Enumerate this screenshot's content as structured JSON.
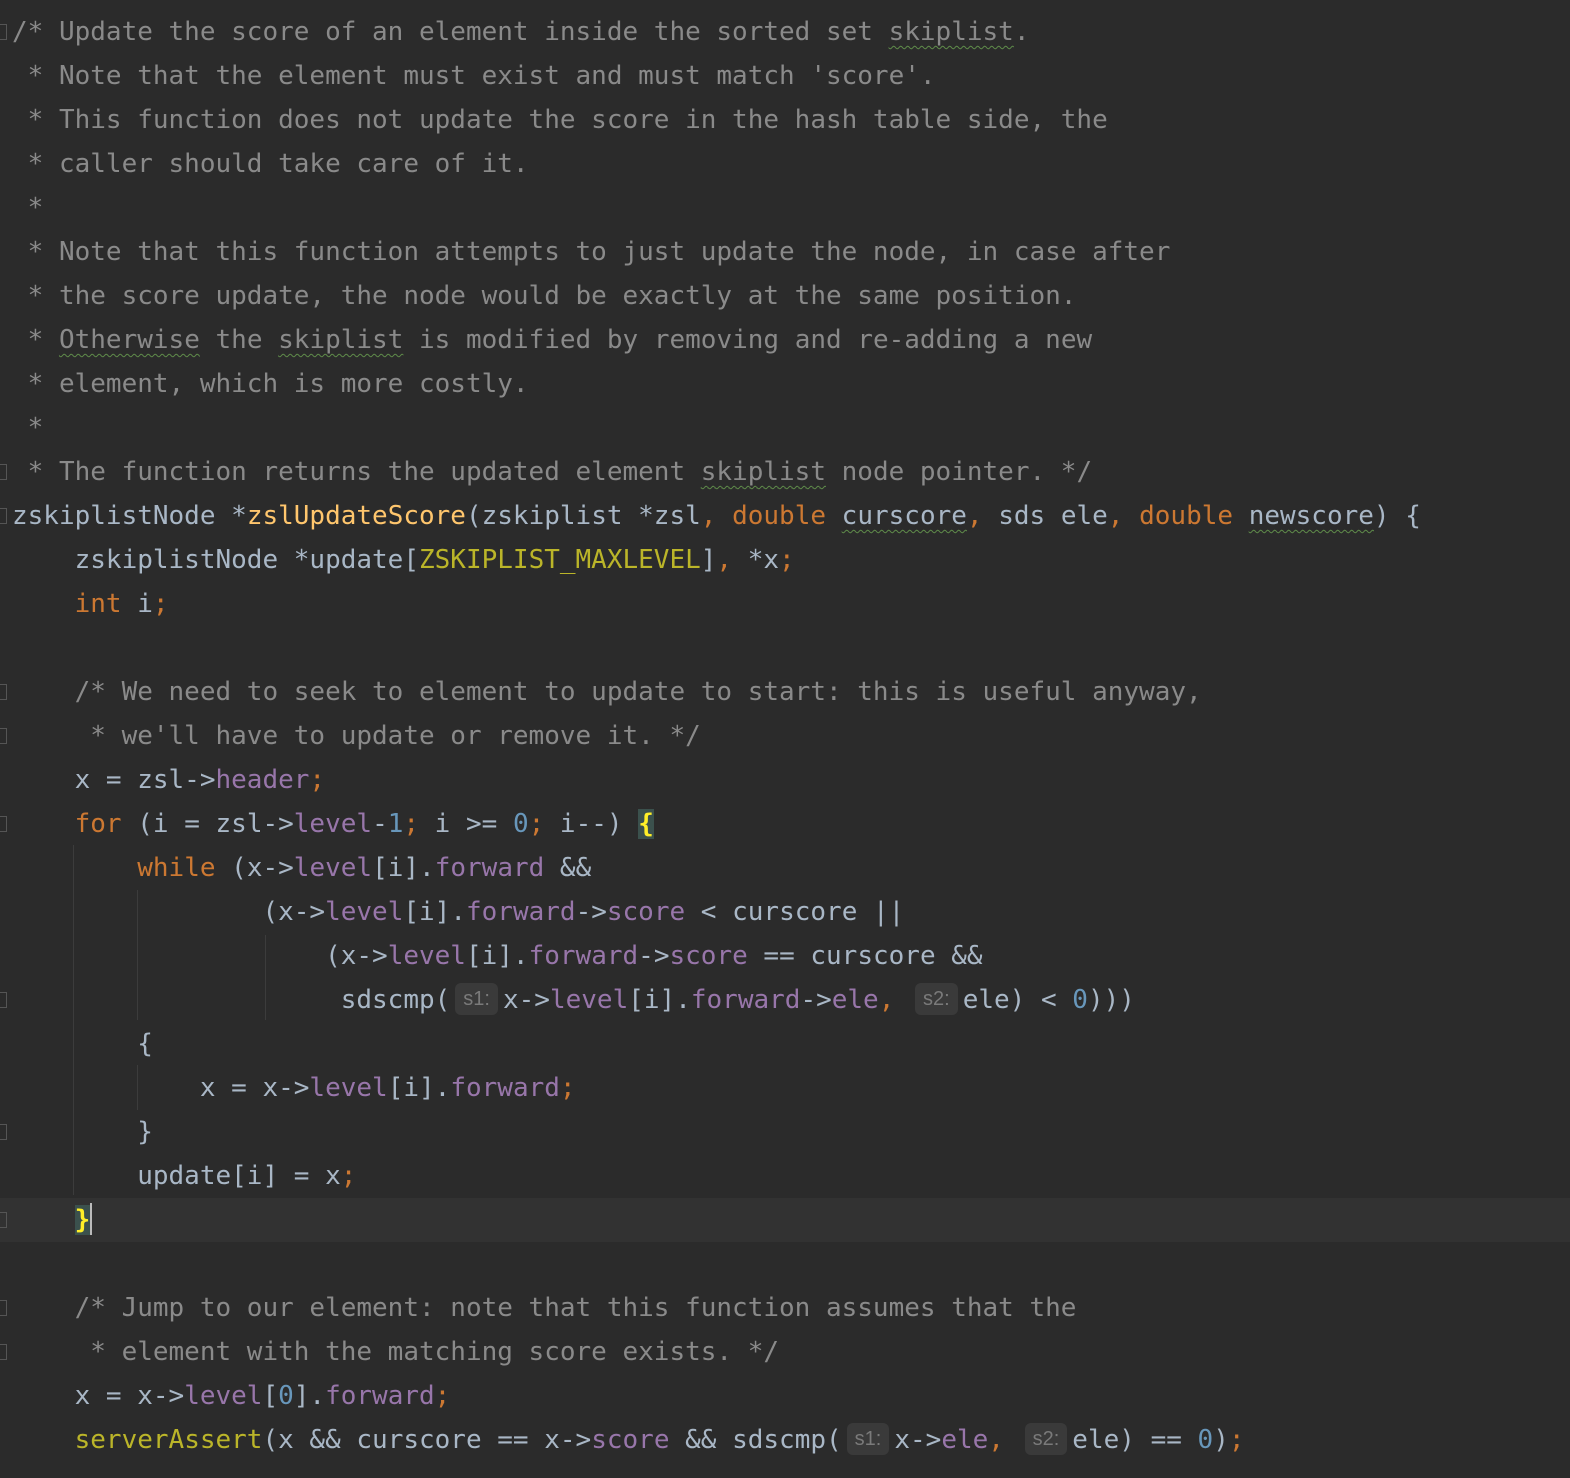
{
  "editor": {
    "language": "C",
    "current_line": 28,
    "colors": {
      "background": "#2b2b2b",
      "text": "#a9b7c6",
      "comment": "#8a8a8a",
      "keyword": "#cc7832",
      "function": "#ffc66d",
      "macro": "#bbb529",
      "field": "#9876aa",
      "number": "#6897bb",
      "matched_brace": "#ffef28"
    },
    "lines": [
      [
        [
          "/* Update the score of an element inside the sorted set ",
          "c"
        ],
        [
          "skiplist",
          "cy"
        ],
        [
          ".",
          "c"
        ]
      ],
      [
        [
          " * Note that the element must exist and must match 'score'.",
          "c"
        ]
      ],
      [
        [
          " * This function does not update the score in the hash table side, the",
          "c"
        ]
      ],
      [
        [
          " * caller should take care of it.",
          "c"
        ]
      ],
      [
        [
          " *",
          "c"
        ]
      ],
      [
        [
          " * Note that this function attempts to just update the node, in case after",
          "c"
        ]
      ],
      [
        [
          " * the score update, the node would be exactly at the same position.",
          "c"
        ]
      ],
      [
        [
          " * ",
          "c"
        ],
        [
          "Otherwise",
          "cy"
        ],
        [
          " the ",
          "c"
        ],
        [
          "skiplist",
          "cy"
        ],
        [
          " is modified by removing and re-adding a new",
          "c"
        ]
      ],
      [
        [
          " * element, which is more costly.",
          "c"
        ]
      ],
      [
        [
          " *",
          "c"
        ]
      ],
      [
        [
          " * The function returns the updated element ",
          "c"
        ],
        [
          "skiplist",
          "cy"
        ],
        [
          " node pointer. */",
          "c"
        ]
      ],
      [
        [
          "zskiplistNode *",
          "t"
        ],
        [
          "zslUpdateScore",
          "f"
        ],
        [
          "(zskiplist *zsl",
          "t"
        ],
        [
          ",",
          "k"
        ],
        [
          " ",
          "t"
        ],
        [
          "double",
          "k"
        ],
        [
          " ",
          "t"
        ],
        [
          "curscore",
          "ty"
        ],
        [
          ",",
          "k"
        ],
        [
          " sds ele",
          "t"
        ],
        [
          ",",
          "k"
        ],
        [
          " ",
          "t"
        ],
        [
          "double",
          "k"
        ],
        [
          " ",
          "t"
        ],
        [
          "newscore",
          "ty"
        ],
        [
          ") {",
          "t"
        ]
      ],
      [
        [
          "    zskiplistNode *update[",
          "t"
        ],
        [
          "ZSKIPLIST_MAXLEVEL",
          "m"
        ],
        [
          "]",
          "t"
        ],
        [
          ",",
          "k"
        ],
        [
          " *x",
          "t"
        ],
        [
          ";",
          "k"
        ]
      ],
      [
        [
          "    ",
          "t"
        ],
        [
          "int",
          "k"
        ],
        [
          " i",
          "t"
        ],
        [
          ";",
          "k"
        ]
      ],
      [],
      [
        [
          "    /* We need to seek to element to update to start: this is useful anyway,",
          "c"
        ]
      ],
      [
        [
          "     * we'll have to update or remove it. */",
          "c"
        ]
      ],
      [
        [
          "    x = zsl->",
          "t"
        ],
        [
          "header",
          "p"
        ],
        [
          ";",
          "k"
        ]
      ],
      [
        [
          "    ",
          "t"
        ],
        [
          "for",
          "k"
        ],
        [
          " (i = zsl->",
          "t"
        ],
        [
          "level",
          "p"
        ],
        [
          "-",
          "t"
        ],
        [
          "1",
          "n"
        ],
        [
          ";",
          "k"
        ],
        [
          " i >= ",
          "t"
        ],
        [
          "0",
          "n"
        ],
        [
          ";",
          "k"
        ],
        [
          " i--) ",
          "t"
        ],
        [
          "{",
          "b"
        ]
      ],
      [
        [
          "        ",
          "t"
        ],
        [
          "while",
          "k"
        ],
        [
          " (x->",
          "t"
        ],
        [
          "level",
          "p"
        ],
        [
          "[i].",
          "t"
        ],
        [
          "forward",
          "p"
        ],
        [
          " &&",
          "t"
        ]
      ],
      [
        [
          "                (x->",
          "t"
        ],
        [
          "level",
          "p"
        ],
        [
          "[i].",
          "t"
        ],
        [
          "forward",
          "p"
        ],
        [
          "->",
          "t"
        ],
        [
          "score",
          "p"
        ],
        [
          " < curscore ||",
          "t"
        ]
      ],
      [
        [
          "                    (x->",
          "t"
        ],
        [
          "level",
          "p"
        ],
        [
          "[i].",
          "t"
        ],
        [
          "forward",
          "p"
        ],
        [
          "->",
          "t"
        ],
        [
          "score",
          "p"
        ],
        [
          " == curscore &&",
          "t"
        ]
      ],
      [
        [
          "                     sdscmp(",
          "t"
        ],
        [
          "s1:",
          "h"
        ],
        [
          "x->",
          "t"
        ],
        [
          "level",
          "p"
        ],
        [
          "[i].",
          "t"
        ],
        [
          "forward",
          "p"
        ],
        [
          "->",
          "t"
        ],
        [
          "ele",
          "p"
        ],
        [
          ",",
          "k"
        ],
        [
          " ",
          "t"
        ],
        [
          "s2:",
          "h"
        ],
        [
          "ele) < ",
          "t"
        ],
        [
          "0",
          "n"
        ],
        [
          ")))",
          "t"
        ]
      ],
      [
        [
          "        {",
          "t"
        ]
      ],
      [
        [
          "            x = x->",
          "t"
        ],
        [
          "level",
          "p"
        ],
        [
          "[i].",
          "t"
        ],
        [
          "forward",
          "p"
        ],
        [
          ";",
          "k"
        ]
      ],
      [
        [
          "        }",
          "t"
        ]
      ],
      [
        [
          "        update[i] = x",
          "t"
        ],
        [
          ";",
          "k"
        ]
      ],
      [
        [
          "    ",
          "t"
        ],
        [
          "}",
          "b"
        ]
      ],
      [],
      [
        [
          "    /* Jump to our element: note that this function assumes that the",
          "c"
        ]
      ],
      [
        [
          "     * element with the matching score exists. */",
          "c"
        ]
      ],
      [
        [
          "    x = x->",
          "t"
        ],
        [
          "level",
          "p"
        ],
        [
          "[",
          "t"
        ],
        [
          "0",
          "n"
        ],
        [
          "].",
          "t"
        ],
        [
          "forward",
          "p"
        ],
        [
          ";",
          "k"
        ]
      ],
      [
        [
          "    ",
          "t"
        ],
        [
          "serverAssert",
          "m"
        ],
        [
          "(x && curscore == x->",
          "t"
        ],
        [
          "score",
          "p"
        ],
        [
          " && sdscmp(",
          "t"
        ],
        [
          "s1:",
          "h"
        ],
        [
          "x->",
          "t"
        ],
        [
          "ele",
          "p"
        ],
        [
          ",",
          "k"
        ],
        [
          " ",
          "t"
        ],
        [
          "s2:",
          "h"
        ],
        [
          "ele) == ",
          "t"
        ],
        [
          "0",
          "n"
        ],
        [
          ")",
          "t"
        ],
        [
          ";",
          "k"
        ]
      ]
    ]
  }
}
